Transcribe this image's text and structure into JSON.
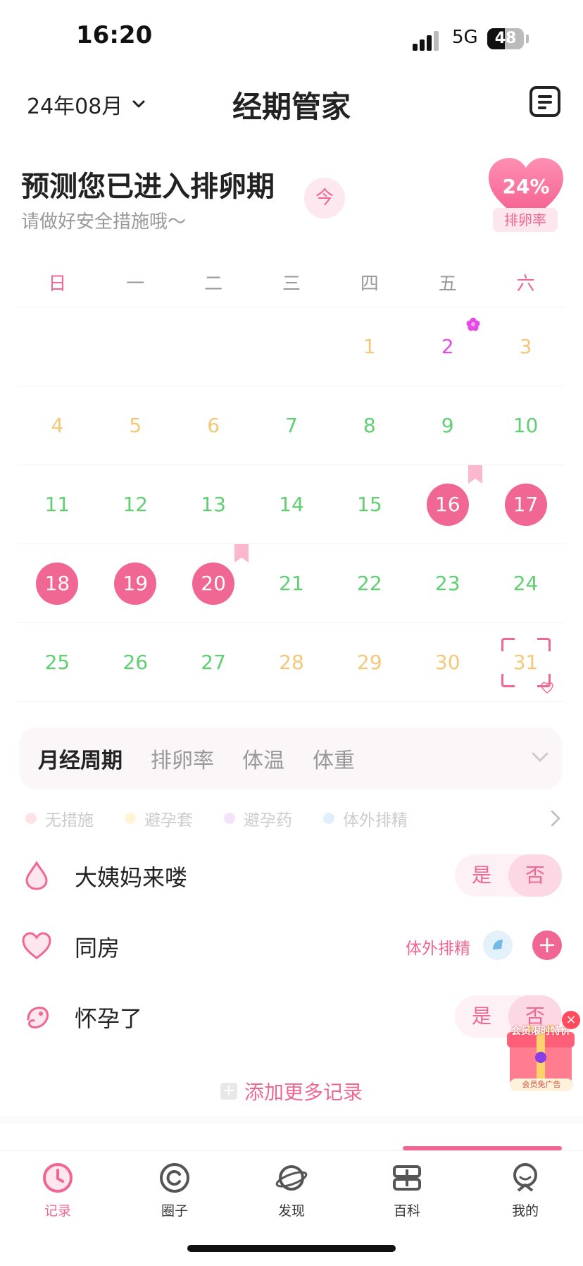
{
  "status": {
    "time": "16:20",
    "network": "5G",
    "battery": "48",
    "battery_level": 0.48
  },
  "header": {
    "month": "24年08月",
    "title": "经期管家"
  },
  "prediction": {
    "title": "预测您已进入排卵期",
    "subtitle": "请做好安全措施哦～",
    "today_btn": "今",
    "ovulation_pct": "24%",
    "ovulation_label": "排卵率"
  },
  "calendar": {
    "weekdays": [
      "日",
      "一",
      "二",
      "三",
      "四",
      "五",
      "六"
    ],
    "rows": [
      [
        "",
        "",
        "",
        "",
        "1",
        "2",
        "3"
      ],
      [
        "4",
        "5",
        "6",
        "7",
        "8",
        "9",
        "10"
      ],
      [
        "11",
        "12",
        "13",
        "14",
        "15",
        "16",
        "17"
      ],
      [
        "18",
        "19",
        "20",
        "21",
        "22",
        "23",
        "24"
      ],
      [
        "25",
        "26",
        "27",
        "28",
        "29",
        "30",
        "31"
      ]
    ]
  },
  "tabs": [
    "月经周期",
    "排卵率",
    "体温",
    "体重"
  ],
  "legend": [
    "无措施",
    "避孕套",
    "避孕药",
    "体外排精"
  ],
  "records": [
    {
      "label": "大姨妈来喽",
      "yes": "是",
      "no": "否"
    },
    {
      "label": "同房",
      "method": "体外排精",
      "plus": "+"
    },
    {
      "label": "怀孕了",
      "yes": "是",
      "no": "否"
    }
  ],
  "add_more": "添加更多记录",
  "ad": {
    "title": "会员限时特价",
    "footer": "会员免广告",
    "close": "×"
  },
  "nav": [
    "记录",
    "圈子",
    "发现",
    "百科",
    "我的"
  ],
  "colors": {
    "accent": "#f06793",
    "future": "#f4c878",
    "safe": "#5fcf72",
    "ovulation": "#e44be4"
  }
}
